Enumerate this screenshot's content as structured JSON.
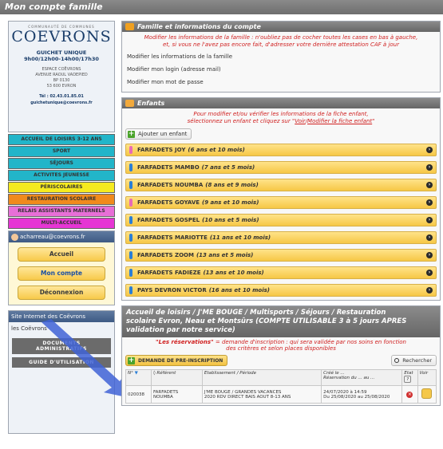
{
  "window": {
    "title": "Mon compte famille"
  },
  "sidebar": {
    "logo_small": "COMMUNAUTÉ DE COMMUNES",
    "logo": "COEVRONS",
    "guichet_title": "GUICHET UNIQUE",
    "guichet_hours": "9h00/12h00-14h00/17h30",
    "address_lines": [
      "ESPACE COËVRONS",
      "AVENUE RAOUL VADEPIED",
      "BP 0130",
      "53 600 EVRON"
    ],
    "tel": "Tél : 02.43.01.85.01",
    "email": "guichetunique@coevrons.fr",
    "services": [
      {
        "label": "ACCUEIL DE LOISIRS 3-12 ANS",
        "color": "#22b5c9"
      },
      {
        "label": "SPORT",
        "color": "#22b5c9"
      },
      {
        "label": "SÉJOURS",
        "color": "#22b5c9"
      },
      {
        "label": "ACTIVITES JEUNESSE",
        "color": "#22b5c9"
      },
      {
        "label": "PÉRISCOLAIRES",
        "color": "#f5ea1f"
      },
      {
        "label": "RESTAURATION SCOLAIRE",
        "color": "#f08a1c"
      },
      {
        "label": "RELAIS ASSISTANTS MATERNELS",
        "color": "#e76fd7"
      },
      {
        "label": "MULTI-ACCUEIL",
        "color": "#e635d4"
      }
    ],
    "account_email": "acharreau@coevrons.fr",
    "account_buttons": [
      "Accueil",
      "Mon compte",
      "Déconnexion"
    ],
    "site_title": "Site Internet des Coëvrons",
    "site_link": "les Coëvrons",
    "site_dark_1_top": "DOCUMENTS",
    "site_dark_1_bottom": "ADMINISTRATIFS",
    "site_dark_2": "GUIDE D'UTILISATION"
  },
  "famille": {
    "title": "Famille et informations du compte",
    "warning_line1": "Modifier les informations de la famille : n'oubliez pas de cocher toutes les cases en bas à gauche,",
    "warning_line2": "et, si vous ne l'avez pas encore fait, d'adresser votre dernière attestation CAF à jour",
    "links": [
      "Modifier les informations de la famille",
      "Modifier mon login (adresse mail)",
      "Modifier mon mot de passe"
    ]
  },
  "enfants": {
    "title": "Enfants",
    "note_line1": "Pour modifier et/ou vérifier les informations de la fiche enfant,",
    "note_line2_prefix": "sélectionnez un enfant et cliquez sur \"",
    "note_link_voir": "Voir",
    "note_link_sep": "/",
    "note_link_modifier": "Modifier la fiche enfant",
    "note_line2_suffix": "\"",
    "add_label": "Ajouter un enfant",
    "list": [
      {
        "name": "FARFADETS JOY",
        "age": "(6 ans et 10 mois)",
        "icon": "#e86ab7"
      },
      {
        "name": "FARFADETS MAMBO",
        "age": "(7 ans et 5 mois)",
        "icon": "#2a7ed6"
      },
      {
        "name": "FARFADETS NOUMBA",
        "age": "(8 ans et 9 mois)",
        "icon": "#2a7ed6"
      },
      {
        "name": "FARFADETS GOYAVE",
        "age": "(9 ans et 10 mois)",
        "icon": "#e86ab7"
      },
      {
        "name": "FARFADETS GOSPEL",
        "age": "(10 ans et 5 mois)",
        "icon": "#2a7ed6"
      },
      {
        "name": "FARFADETS MARIOTTE",
        "age": "(11 ans et 10 mois)",
        "icon": "#2a7ed6"
      },
      {
        "name": "FARFADETS ZOOM",
        "age": "(13 ans et 5 mois)",
        "icon": "#2a7ed6"
      },
      {
        "name": "FARFADETS FADIEZE",
        "age": "(13 ans et 10 mois)",
        "icon": "#2a7ed6"
      },
      {
        "name": "PAYS DEVRON VICTOR",
        "age": "(16 ans et 10 mois)",
        "icon": "#2a7ed6"
      }
    ]
  },
  "accueil": {
    "title_line1": "Accueil de loisirs / J'ME BOUGE / Multisports / Séjours / Restauration",
    "title_line2": "scolaire Evron, Neau et Montsûrs (COMPTE UTILISABLE 3 à 5 jours APRES",
    "title_line3": "validation par notre service)",
    "note_bold": "\"Les réservations\"",
    "note_rest": " = demande d'inscription : qui sera validée par nos soins en fonction",
    "note_line2": "des critères et selon places disponibles",
    "pre_label": "DEMANDE DE PRE-INSCRIPTION",
    "search_label": "Rechercher",
    "headers": [
      "N°",
      "◊ Référent",
      "Etablissement / Période",
      "Créé le ...",
      "Réservation du ... au ...",
      "Etat",
      "Voir"
    ],
    "rows": [
      {
        "num": "020038",
        "referent_1": "FARFADETS",
        "referent_2": "NOUMBA",
        "etab_1": "J'ME BOUGE / GRANDES VACANCES",
        "etab_2": "2020 RDV DIRECT BAIS AOUT 8-13 ANS",
        "cree": "24/07/2020 à 14:59",
        "resa": "Du 25/08/2020 au 25/08/2020"
      }
    ]
  }
}
